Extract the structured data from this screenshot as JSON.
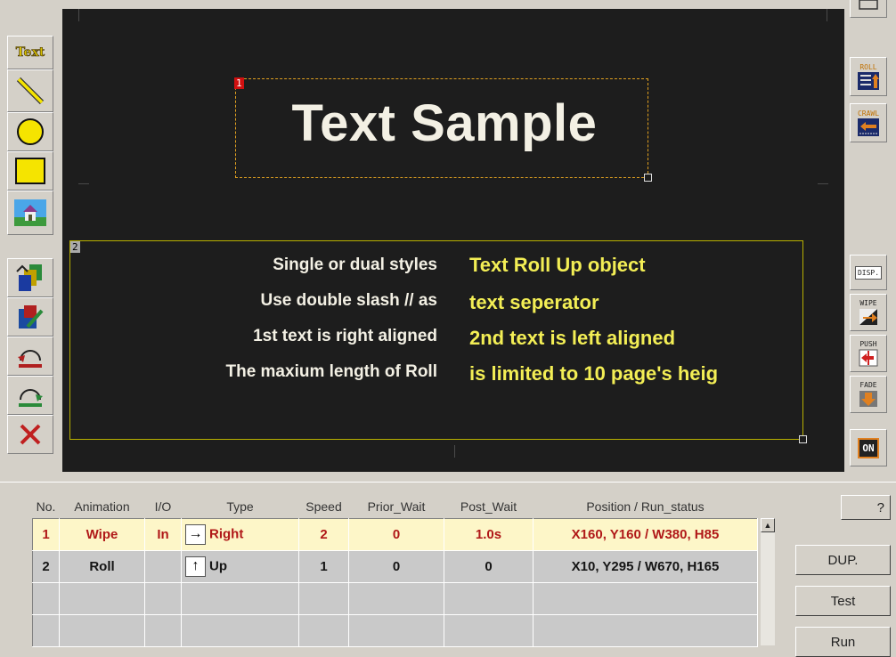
{
  "left_toolbar": {
    "text_tool_label": "Text",
    "tools": [
      "text-tool",
      "line-tool",
      "ellipse-tool",
      "rectangle-tool",
      "image-tool",
      "layer-order-tool",
      "edit-tool",
      "roll-down-tool",
      "roll-up-tool",
      "delete-tool"
    ]
  },
  "right_toolbar": {
    "roll_label": "ROLL",
    "crawl_label": "CRAWL",
    "disp_label": "DISP.",
    "wipe_label": "WIPE",
    "push_label": "PUSH",
    "fade_label": "FADE",
    "on_label": "ON"
  },
  "stage": {
    "object1": {
      "num": "1",
      "text": "Text Sample"
    },
    "object2": {
      "num": "2",
      "left_lines": [
        "Single or dual styles",
        "Use double slash // as",
        "1st text is right aligned",
        "The maxium length of Roll"
      ],
      "right_lines": [
        "Text Roll Up object",
        "text seperator",
        "2nd text is left aligned",
        "is limited to 10 page's heig"
      ]
    }
  },
  "table": {
    "headers": [
      "No.",
      "Animation",
      "I/O",
      "Type",
      "Speed",
      "Prior_Wait",
      "Post_Wait",
      "Position / Run_status"
    ],
    "rows": [
      {
        "no": "1",
        "animation": "Wipe",
        "io": "In",
        "type_arrow": "→",
        "type": "Right",
        "speed": "2",
        "prior_wait": "0",
        "post_wait": "1.0s",
        "position": "X160, Y160 / W380, H85"
      },
      {
        "no": "2",
        "animation": "Roll",
        "io": "",
        "type_arrow": "↑",
        "type": "Up",
        "speed": "1",
        "prior_wait": "0",
        "post_wait": "0",
        "position": "X10, Y295 / W670, H165"
      }
    ]
  },
  "buttons": {
    "help": "?",
    "dup": "DUP.",
    "test": "Test",
    "run": "Run"
  },
  "colors": {
    "stage_bg": "#1d1d1d",
    "title_text": "#f3f0e4",
    "accent_yellow": "#f3ee55",
    "row_selected": "#fdf6c8",
    "row_selected_text": "#b01818"
  }
}
